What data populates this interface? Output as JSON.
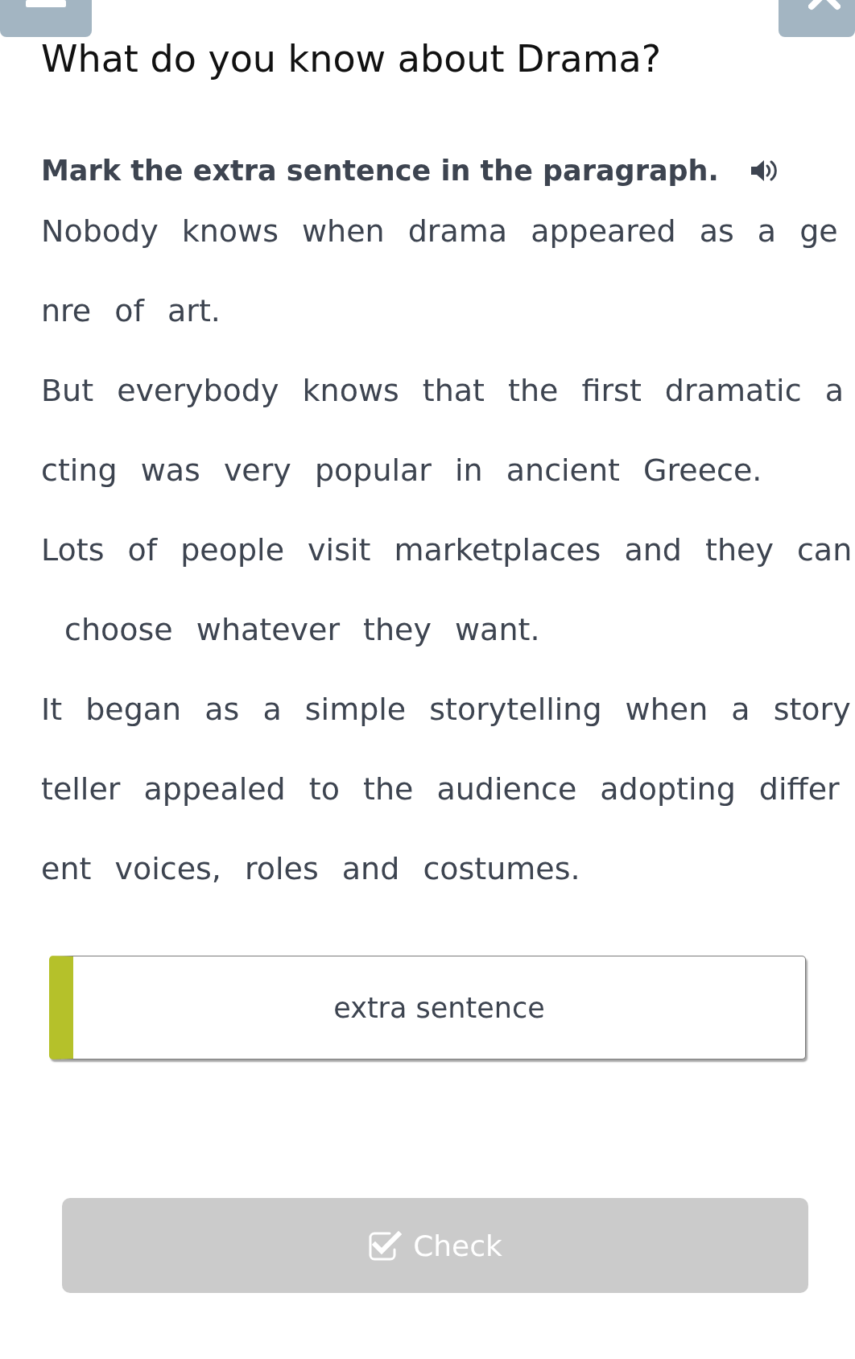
{
  "title": "What do you know about Drama?",
  "task": {
    "instruction": "Mark the extra sentence in the paragraph."
  },
  "paragraph": {
    "sentences": [
      {
        "lines": [
          "Nobody knows when drama appeared as a ge",
          "nre of art."
        ],
        "selected": false
      },
      {
        "lines": [
          "But everybody knows that the first dramatic a",
          "cting was very popular in ancient Greece."
        ],
        "selected": false
      },
      {
        "lines": [
          "Lots of people visit marketplaces and they can",
          " choose whatever they want."
        ],
        "selected": false
      },
      {
        "lines": [
          "It began as a simple storytelling when a story",
          "teller appealed to the audience adopting differ",
          "ent voices, roles and costumes."
        ],
        "selected": false
      }
    ]
  },
  "options": [
    {
      "label": "extra sentence"
    }
  ],
  "check_button": {
    "label": "Check",
    "disabled": true
  }
}
